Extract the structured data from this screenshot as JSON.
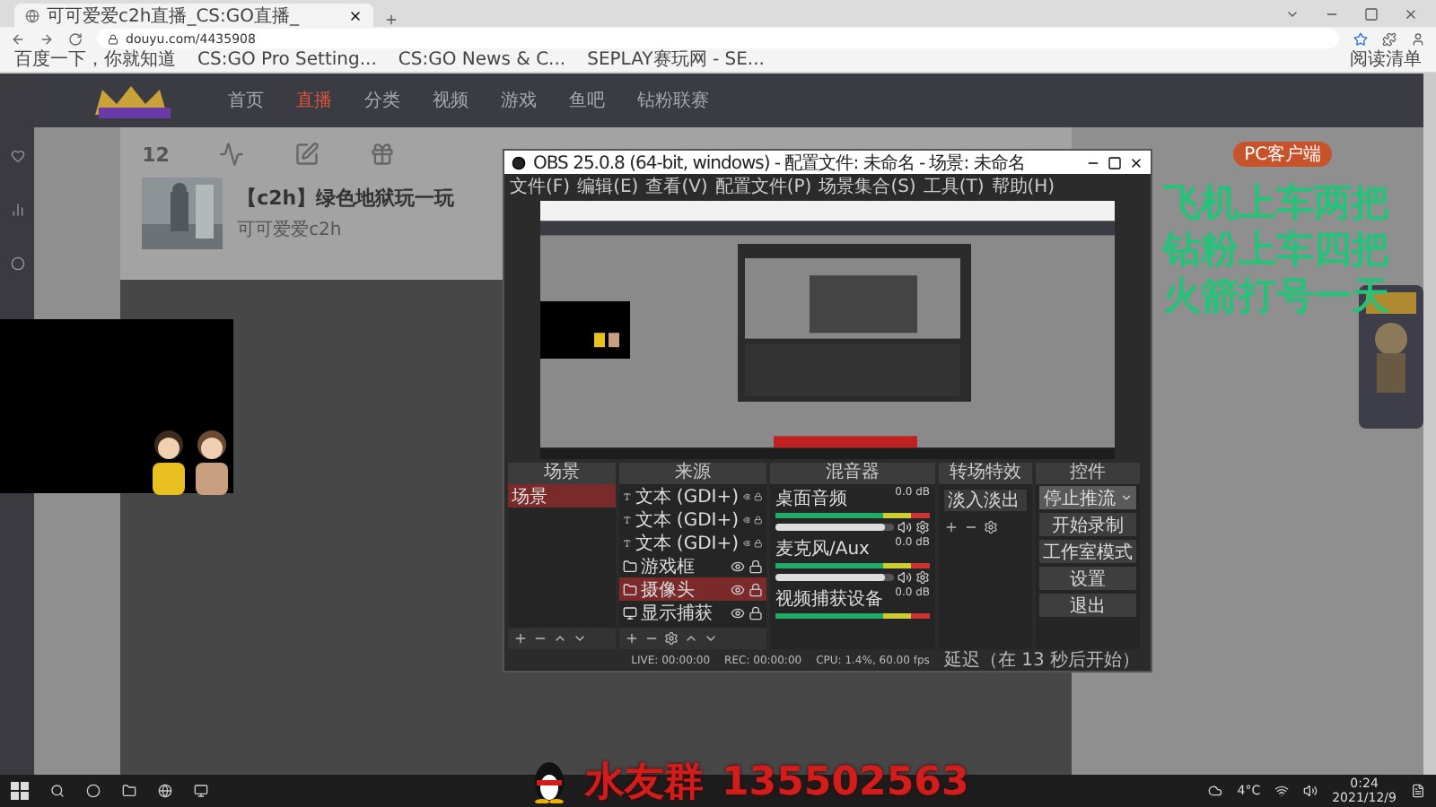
{
  "browser": {
    "tab_title": "可可爱爱c2h直播_CS:GO直播_",
    "address": "douyu.com/4435908",
    "bookmarks": [
      {
        "label": "百度一下，你就知道"
      },
      {
        "label": "CS:GO Pro Setting..."
      },
      {
        "label": "CS:GO News & C..."
      },
      {
        "label": "SEPLAY赛玩网 - SE..."
      }
    ],
    "reading_list": "阅读清单"
  },
  "site": {
    "nav": [
      {
        "label": "首页",
        "selected": false
      },
      {
        "label": "直播",
        "selected": true
      },
      {
        "label": "分类",
        "selected": false
      },
      {
        "label": "视频",
        "selected": false
      },
      {
        "label": "游戏",
        "selected": false
      },
      {
        "label": "鱼吧",
        "selected": false
      },
      {
        "label": "钻粉联赛",
        "selected": false
      }
    ],
    "score": "12",
    "room_title": "【c2h】绿色地狱玩一玩",
    "streamer": "可可爱爱c2h",
    "pc_badge": "PC客户端"
  },
  "overlay_lines": [
    "飞机上车两把",
    "钻粉上车四把",
    "火箭打号一天"
  ],
  "qq_group": {
    "label": "水友群",
    "number": "135502563"
  },
  "obs": {
    "title": "OBS 25.0.8 (64-bit, windows) - 配置文件: 未命名 - 场景: 未命名",
    "menu": [
      "文件(F)",
      "编辑(E)",
      "查看(V)",
      "配置文件(P)",
      "场景集合(S)",
      "工具(T)",
      "帮助(H)"
    ],
    "scenes": {
      "title": "场景",
      "items": [
        {
          "label": "场景",
          "selected": true
        }
      ]
    },
    "sources": {
      "title": "来源",
      "items": [
        {
          "label": "文本 (GDI+)",
          "kind": "text",
          "selected": false
        },
        {
          "label": "文本 (GDI+)",
          "kind": "text",
          "selected": false
        },
        {
          "label": "文本 (GDI+)",
          "kind": "text",
          "selected": false
        },
        {
          "label": "游戏框",
          "kind": "group",
          "selected": false
        },
        {
          "label": "摄像头",
          "kind": "group",
          "selected": true
        },
        {
          "label": "显示捕获",
          "kind": "display",
          "selected": false
        }
      ]
    },
    "mixer": {
      "title": "混音器",
      "channels": [
        {
          "name": "桌面音频",
          "reading": "0.0 dB",
          "level": 0.93
        },
        {
          "name": "麦克风/Aux",
          "reading": "0.0 dB",
          "level": 0.93
        },
        {
          "name": "视频捕获设备",
          "reading": "0.0 dB"
        }
      ]
    },
    "transitions": {
      "title": "转场特效",
      "value": "淡入淡出"
    },
    "controls": {
      "title": "控件",
      "buttons": [
        {
          "label": "停止推流",
          "menu": true
        },
        {
          "label": "开始录制",
          "menu": false
        },
        {
          "label": "工作室模式",
          "menu": false
        },
        {
          "label": "设置",
          "menu": false
        },
        {
          "label": "退出",
          "menu": false
        }
      ]
    },
    "status": {
      "live": "LIVE: 00:00:00",
      "rec": "REC: 00:00:00",
      "cpu": "CPU: 1.4%, 60.00 fps",
      "delay": "延迟（在 13 秒后开始）"
    }
  },
  "taskbar": {
    "weather": "4°C",
    "time": "0:24",
    "date": "2021/12/9"
  }
}
